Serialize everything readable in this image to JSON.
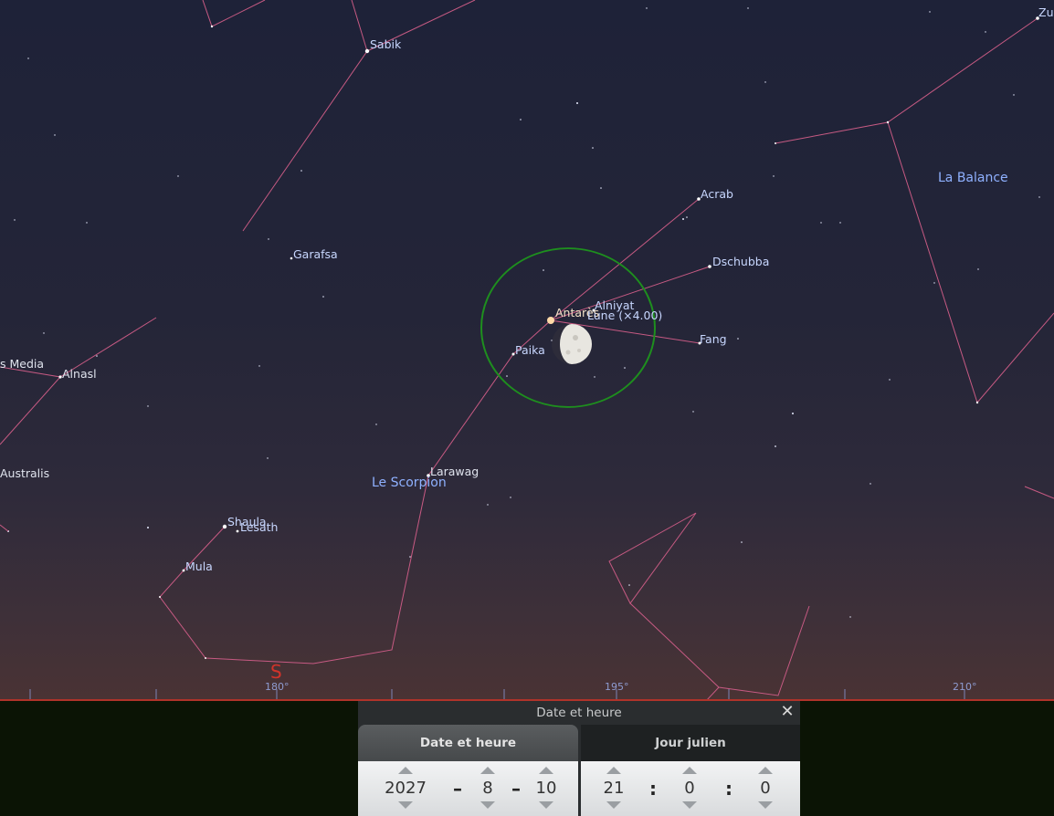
{
  "sky": {
    "stars": [
      "Sabik",
      "Garafsa",
      "Acrab",
      "Dschubba",
      "Alniyat",
      "Antarès",
      "Lune (×4.00)",
      "Paika",
      "Fang",
      "Larawag",
      "Alnasl",
      "Shaula",
      "Lesath",
      "Mula",
      "Zul",
      "s Media",
      "Australis"
    ],
    "constellations": [
      "Le Scorpion",
      "La Balance"
    ],
    "degrees": [
      "180°",
      "195°",
      "210°"
    ],
    "cardinal": "S"
  },
  "dialog": {
    "title": "Date et heure",
    "close_symbol": "✕",
    "tabs": {
      "date": "Date et heure",
      "julian": "Jour julien"
    },
    "date": {
      "year": "2027",
      "sep1": "–",
      "month": "8",
      "sep2": "–",
      "day": "10"
    },
    "time": {
      "hour": "21",
      "sep1": ":",
      "minute": "0",
      "sep2": ":",
      "second": "0"
    }
  }
}
